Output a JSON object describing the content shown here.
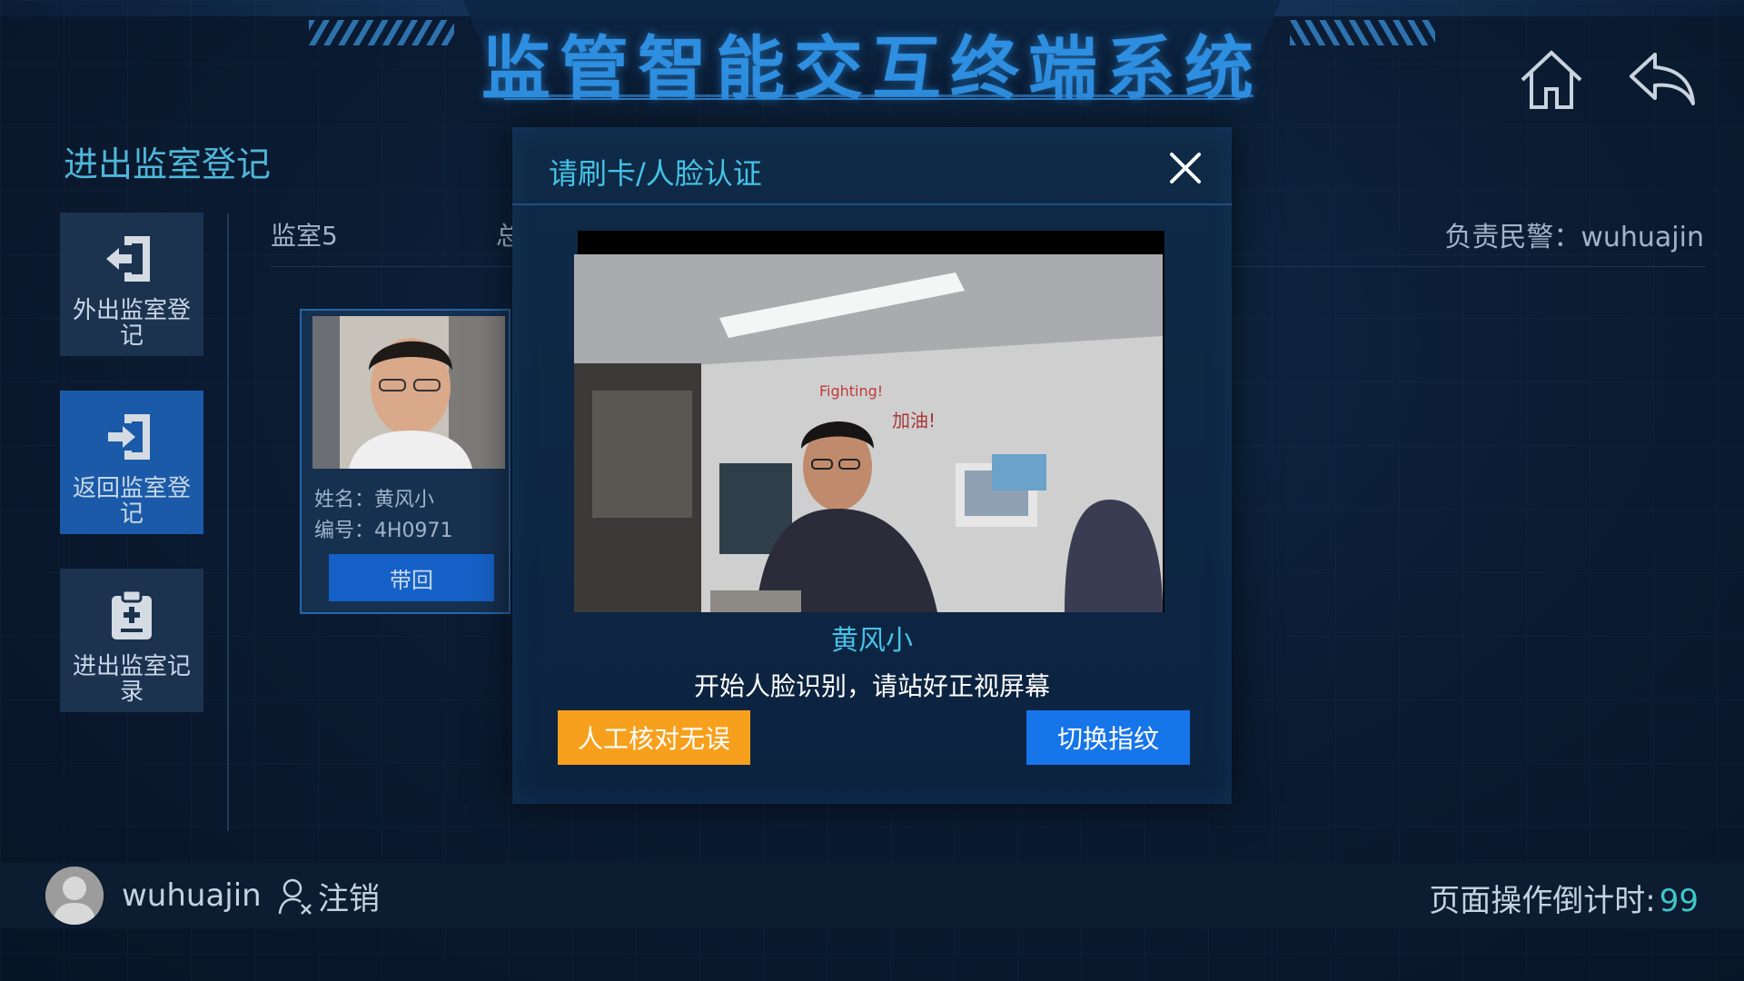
{
  "header": {
    "title": "监管智能交互终端系统"
  },
  "page": {
    "section_title": "进出监室登记"
  },
  "sidebar": {
    "items": [
      {
        "label": "外出监室登记",
        "icon": "exit-door-icon",
        "active": false
      },
      {
        "label": "返回监室登记",
        "icon": "enter-door-icon",
        "active": true
      },
      {
        "label": "进出监室记录",
        "icon": "clipboard-icon",
        "active": false
      }
    ]
  },
  "content": {
    "room": "监室5",
    "room_extra": "总",
    "officer": "负责民警：wuhuajin"
  },
  "person": {
    "name": "姓名：黄风小",
    "code": "编号：4H0971",
    "action": "带回"
  },
  "modal": {
    "title": "请刷卡/人脸认证",
    "recognized_name": "黄风小",
    "instruction": "开始人脸识别，请站好正视屏幕",
    "manual_button": "人工核对无误",
    "fingerprint_button": "切换指纹"
  },
  "footer": {
    "username": "wuhuajin",
    "logout": "注销",
    "countdown_label": "页面操作倒计时:",
    "countdown_value": "99"
  },
  "colors": {
    "accent_cyan": "#45c2e6",
    "title_blue": "#2e8ee0",
    "button_orange": "#f7a01d",
    "button_blue": "#1775ea",
    "active_tile": "#1a5aa8"
  }
}
